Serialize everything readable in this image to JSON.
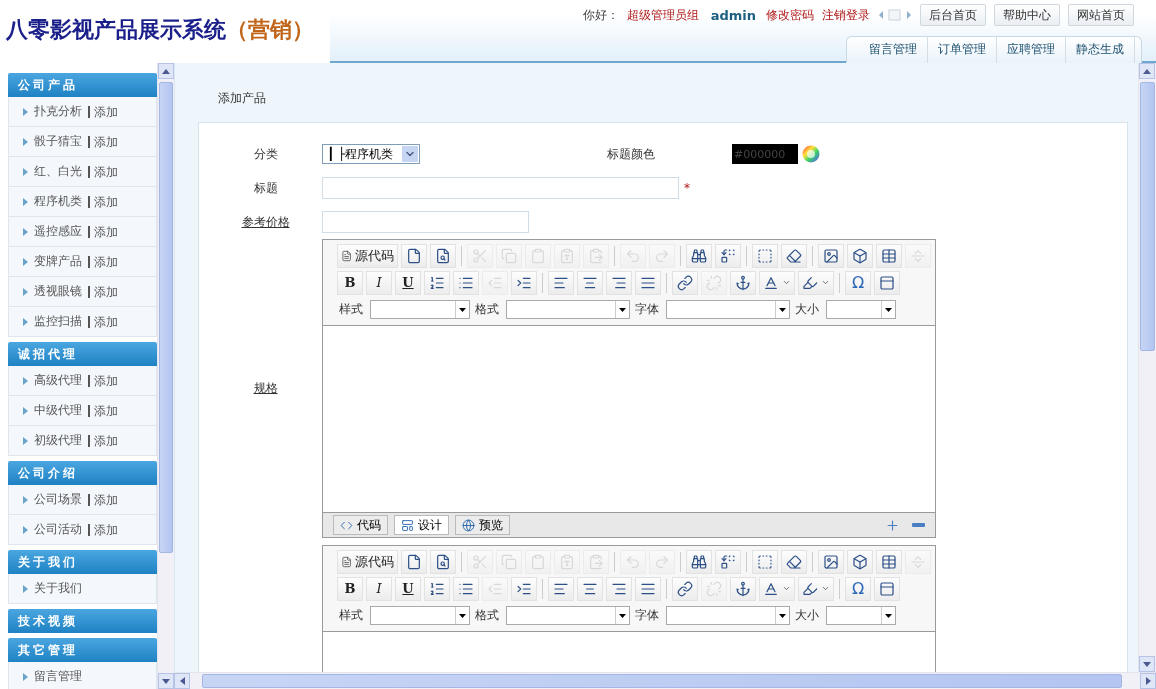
{
  "header": {
    "title": "八零影视产品展示系统",
    "title_suffix": "（营销）",
    "greeting": "你好：",
    "role": "超级管理员组",
    "user": "admin",
    "links": [
      "修改密码",
      "注销登录"
    ],
    "buttons": [
      "后台首页",
      "帮助中心",
      "网站首页"
    ],
    "tabs": [
      "留言管理",
      "订单管理",
      "应聘管理",
      "静态生成"
    ]
  },
  "sidebar": {
    "sections": [
      {
        "title": "公司产品",
        "items": [
          {
            "label": "扑克分析",
            "action": "添加"
          },
          {
            "label": "骰子猜宝",
            "action": "添加"
          },
          {
            "label": "红、白光",
            "action": "添加"
          },
          {
            "label": "程序机类",
            "action": "添加"
          },
          {
            "label": "遥控感应",
            "action": "添加"
          },
          {
            "label": "变牌产品",
            "action": "添加"
          },
          {
            "label": "透视眼镜",
            "action": "添加"
          },
          {
            "label": "监控扫描",
            "action": "添加"
          }
        ]
      },
      {
        "title": "诚招代理",
        "items": [
          {
            "label": "高级代理",
            "action": "添加"
          },
          {
            "label": "中级代理",
            "action": "添加"
          },
          {
            "label": "初级代理",
            "action": "添加"
          }
        ]
      },
      {
        "title": "公司介绍",
        "items": [
          {
            "label": "公司场景",
            "action": "添加"
          },
          {
            "label": "公司活动",
            "action": "添加"
          }
        ]
      },
      {
        "title": "关于我们",
        "items": [
          {
            "label": "关于我们"
          }
        ]
      },
      {
        "title": "技术视频"
      },
      {
        "title": "其它管理",
        "items": [
          {
            "label": "留言管理"
          }
        ]
      }
    ]
  },
  "page": {
    "title": "添加产品"
  },
  "form": {
    "category": {
      "label": "分类",
      "value": "┃ ├程序机类"
    },
    "title_color": {
      "label": "标题颜色",
      "value": "#000000"
    },
    "title": {
      "label": "标题",
      "required_mark": "*"
    },
    "price": {
      "label": "参考价格"
    },
    "editors": [
      {
        "label": "规格",
        "toolbar": [
          [
            {
              "kind": "source",
              "text": "源代码",
              "disabled": false
            },
            {
              "kind": "button",
              "disabled": false
            },
            {
              "kind": "button",
              "disabled": false
            },
            {
              "kind": "separator"
            },
            {
              "kind": "button",
              "disabled": true
            },
            {
              "kind": "button",
              "disabled": true
            },
            {
              "kind": "button",
              "disabled": true
            },
            {
              "kind": "button",
              "disabled": true
            },
            {
              "kind": "button",
              "disabled": true
            },
            {
              "kind": "separator"
            },
            {
              "kind": "button",
              "disabled": true
            },
            {
              "kind": "button",
              "disabled": true
            },
            {
              "kind": "separator"
            },
            {
              "kind": "button",
              "disabled": false
            },
            {
              "kind": "button",
              "disabled": false
            },
            {
              "kind": "separator"
            },
            {
              "kind": "button",
              "disabled": false
            },
            {
              "kind": "button",
              "disabled": false
            },
            {
              "kind": "separator"
            },
            {
              "kind": "button",
              "disabled": false
            },
            {
              "kind": "button",
              "disabled": false
            },
            {
              "kind": "button",
              "disabled": false
            },
            {
              "kind": "button",
              "disabled": true
            }
          ],
          [
            {
              "kind": "text",
              "text": "B",
              "disabled": false
            },
            {
              "kind": "text",
              "text": "I",
              "disabled": false
            },
            {
              "kind": "text",
              "text": "U",
              "disabled": false
            },
            {
              "kind": "button",
              "disabled": false
            },
            {
              "kind": "button",
              "disabled": false
            },
            {
              "kind": "button",
              "disabled": true
            },
            {
              "kind": "button",
              "disabled": false
            },
            {
              "kind": "separator"
            },
            {
              "kind": "button",
              "disabled": false
            },
            {
              "kind": "button",
              "disabled": false
            },
            {
              "kind": "button",
              "disabled": false
            },
            {
              "kind": "button",
              "disabled": false
            },
            {
              "kind": "separator"
            },
            {
              "kind": "button",
              "disabled": false
            },
            {
              "kind": "button",
              "disabled": true
            },
            {
              "kind": "button",
              "disabled": false
            },
            {
              "kind": "menu",
              "disabled": false
            },
            {
              "kind": "menu",
              "disabled": false
            },
            {
              "kind": "separator"
            },
            {
              "kind": "text",
              "text": "Ω",
              "disabled": false
            },
            {
              "kind": "button",
              "disabled": false
            }
          ]
        ],
        "selects": [
          "样式",
          "格式",
          "字体",
          "大小"
        ],
        "modes": [
          {
            "label": "代码",
            "selected": false
          },
          {
            "label": "设计",
            "selected": true
          },
          {
            "label": "预览",
            "selected": false
          }
        ]
      },
      {
        "toolbar": [
          [
            {
              "kind": "source",
              "text": "源代码",
              "disabled": false
            },
            {
              "kind": "button",
              "disabled": false
            },
            {
              "kind": "button",
              "disabled": false
            },
            {
              "kind": "separator"
            },
            {
              "kind": "button",
              "disabled": true
            },
            {
              "kind": "button",
              "disabled": true
            },
            {
              "kind": "button",
              "disabled": true
            },
            {
              "kind": "button",
              "disabled": true
            },
            {
              "kind": "button",
              "disabled": true
            },
            {
              "kind": "separator"
            },
            {
              "kind": "button",
              "disabled": true
            },
            {
              "kind": "button",
              "disabled": true
            },
            {
              "kind": "separator"
            },
            {
              "kind": "button",
              "disabled": false
            },
            {
              "kind": "button",
              "disabled": false
            },
            {
              "kind": "separator"
            },
            {
              "kind": "button",
              "disabled": false
            },
            {
              "kind": "button",
              "disabled": false
            },
            {
              "kind": "separator"
            },
            {
              "kind": "button",
              "disabled": false
            },
            {
              "kind": "button",
              "disabled": false
            },
            {
              "kind": "button",
              "disabled": false
            },
            {
              "kind": "button",
              "disabled": true
            }
          ],
          [
            {
              "kind": "text",
              "text": "B",
              "disabled": false
            },
            {
              "kind": "text",
              "text": "I",
              "disabled": false
            },
            {
              "kind": "text",
              "text": "U",
              "disabled": false
            },
            {
              "kind": "button",
              "disabled": false
            },
            {
              "kind": "button",
              "disabled": false
            },
            {
              "kind": "button",
              "disabled": true
            },
            {
              "kind": "button",
              "disabled": false
            },
            {
              "kind": "separator"
            },
            {
              "kind": "button",
              "disabled": false
            },
            {
              "kind": "button",
              "disabled": false
            },
            {
              "kind": "button",
              "disabled": false
            },
            {
              "kind": "button",
              "disabled": false
            },
            {
              "kind": "separator"
            },
            {
              "kind": "button",
              "disabled": false
            },
            {
              "kind": "button",
              "disabled": true
            },
            {
              "kind": "button",
              "disabled": false
            },
            {
              "kind": "menu",
              "disabled": false
            },
            {
              "kind": "menu",
              "disabled": false
            },
            {
              "kind": "separator"
            },
            {
              "kind": "text",
              "text": "Ω",
              "disabled": false
            },
            {
              "kind": "button",
              "disabled": false
            }
          ]
        ],
        "selects": [
          "样式",
          "格式",
          "字体",
          "大小"
        ]
      }
    ]
  }
}
